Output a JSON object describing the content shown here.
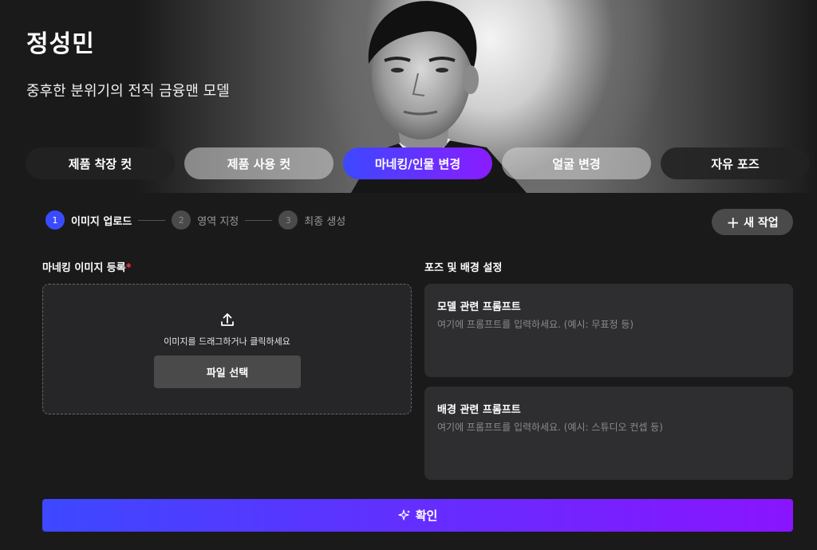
{
  "hero": {
    "title": "정성민",
    "subtitle": "중후한 분위기의 전직 금융맨 모델"
  },
  "tabs": [
    {
      "label": "제품 착장 컷",
      "active": false
    },
    {
      "label": "제품 사용 컷",
      "active": false
    },
    {
      "label": "마네킹/인물 변경",
      "active": true
    },
    {
      "label": "얼굴 변경",
      "active": false
    },
    {
      "label": "자유 포즈",
      "active": false
    }
  ],
  "stepper": {
    "steps": [
      {
        "num": "1",
        "label": "이미지 업로드",
        "active": true
      },
      {
        "num": "2",
        "label": "영역 지정",
        "active": false
      },
      {
        "num": "3",
        "label": "최종 생성",
        "active": false
      }
    ]
  },
  "new_task": {
    "icon": "plus-icon",
    "label": "새 작업"
  },
  "upload": {
    "section_label": "마네킹 이미지 등록",
    "required_mark": "*",
    "icon": "upload-icon",
    "hint": "이미지를 드래그하거나 클릭하세요",
    "button": "파일 선택"
  },
  "settings": {
    "section_label": "포즈 및 배경 설정",
    "model_prompt": {
      "title": "모델 관련 프롬프트",
      "placeholder": "여기에 프롬프트를 입력하세요. (예시: 무표정 등)"
    },
    "background_prompt": {
      "title": "배경 관련 프롬프트",
      "placeholder": "여기에 프롬프트를 입력하세요. (예시: 스튜디오 컨셉 등)"
    }
  },
  "confirm": {
    "icon": "sparkle-icon",
    "label": "확인"
  },
  "colors": {
    "accent_start": "#3d48ff",
    "accent_end": "#8a14ff",
    "background": "#1a1a1a",
    "required": "#ff3a3a"
  }
}
